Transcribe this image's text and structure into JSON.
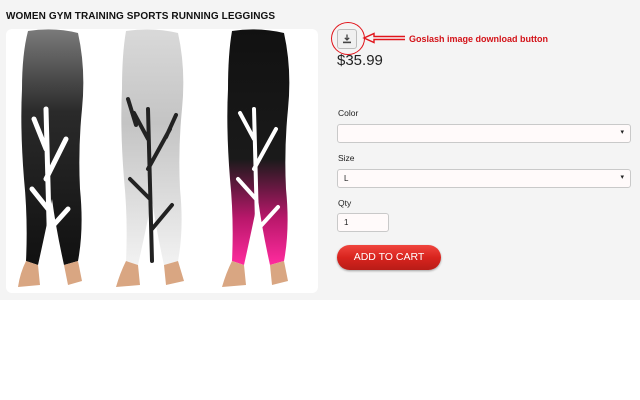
{
  "product": {
    "title": "WOMEN GYM TRAINING SPORTS RUNNING LEGGINGS",
    "price": "$35.99",
    "image_alt_icon": "leggings-product-photo"
  },
  "annotation": {
    "text": "Goslash image download button",
    "color": "#d31218"
  },
  "download_button": {
    "icon": "download-icon"
  },
  "form": {
    "color_label": "Color",
    "color_value": "",
    "size_label": "Size",
    "size_value": "L",
    "qty_label": "Qty",
    "qty_value": "1",
    "caret": "▾"
  },
  "cart": {
    "label": "ADD TO CART",
    "color": "#d8241e"
  },
  "colors": {
    "panel": "#f4f4f4",
    "accent": "#e1141b"
  }
}
